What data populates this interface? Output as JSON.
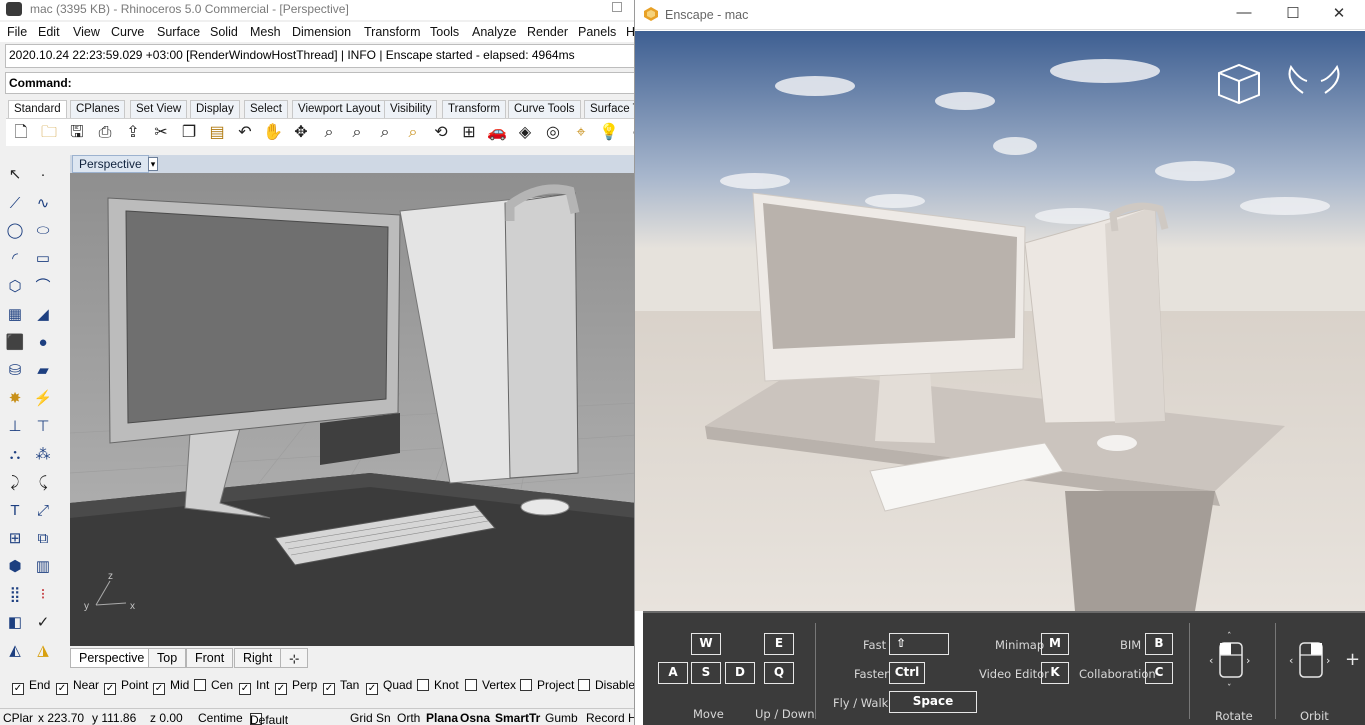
{
  "rhino": {
    "title": "mac (3395 KB) - Rhinoceros 5.0 Commercial - [Perspective]",
    "menu": [
      "File",
      "Edit",
      "View",
      "Curve",
      "Surface",
      "Solid",
      "Mesh",
      "Dimension",
      "Transform",
      "Tools",
      "Analyze",
      "Render",
      "Panels",
      "H"
    ],
    "history_line": "2020.10.24 22:23:59.029 +03:00 [RenderWindowHostThread] | INFO | Enscape started - elapsed: 4964ms",
    "command_label": "Command:",
    "toolbar_tabs": [
      "Standard",
      "CPlanes",
      "Set View",
      "Display",
      "Select",
      "Viewport Layout",
      "Visibility",
      "Transform",
      "Curve Tools",
      "Surface T"
    ],
    "toolbar_icons": [
      "new-icon",
      "open-icon",
      "save-icon",
      "print-icon",
      "import-icon",
      "cut-icon",
      "copy-icon",
      "paste-icon",
      "undo-icon",
      "pan-icon",
      "rotate-view-icon",
      "zoom-icon",
      "zoom-window-icon",
      "zoom-extents-icon",
      "zoom-selected-icon",
      "rotate-icon",
      "four-viewports-icon",
      "car-icon",
      "mesh-icon",
      "target-icon",
      "osnap-icon",
      "light-icon",
      "render-icon"
    ],
    "viewport_label": "Perspective",
    "axis_labels": [
      "y",
      "x",
      "z"
    ],
    "viewport_tabs": [
      "Perspective",
      "Top",
      "Front",
      "Right"
    ],
    "osnaps": [
      {
        "label": "End",
        "checked": true
      },
      {
        "label": "Near",
        "checked": true
      },
      {
        "label": "Point",
        "checked": true
      },
      {
        "label": "Mid",
        "checked": true
      },
      {
        "label": "Cen",
        "checked": false
      },
      {
        "label": "Int",
        "checked": true
      },
      {
        "label": "Perp",
        "checked": true
      },
      {
        "label": "Tan",
        "checked": true
      },
      {
        "label": "Quad",
        "checked": true
      },
      {
        "label": "Knot",
        "checked": false
      },
      {
        "label": "Vertex",
        "checked": false
      },
      {
        "label": "Project",
        "checked": false
      },
      {
        "label": "Disable",
        "checked": false
      }
    ],
    "status": {
      "cplane": "CPlar",
      "x": "x 223.70",
      "y": "y 111.86",
      "z": "z 0.00",
      "units": "Centime",
      "layer": "Default",
      "grid_snap": "Grid Sn",
      "ortho": "Orth",
      "planar": "Plana",
      "osnap": "Osna",
      "smarttrack": "SmartTr",
      "gumball": "Gumb",
      "record": "Record H"
    }
  },
  "enscape": {
    "title": "Enscape - mac",
    "help": {
      "move_keys": [
        "W",
        "A",
        "S",
        "D"
      ],
      "updown_keys": [
        "E",
        "Q"
      ],
      "move_label": "Move",
      "updown_label": "Up / Down",
      "fast_label": "Fast",
      "fast_key": "⇧",
      "faster_label": "Faster",
      "faster_key": "Ctrl",
      "fly_label": "Fly /  Walk",
      "fly_key": "Space",
      "minimap_label": "Minimap",
      "minimap_key": "M",
      "video_label": "Video Editor",
      "video_key": "K",
      "bim_label": "BIM",
      "bim_key": "B",
      "collab_label": "Collaboration",
      "collab_key": "C",
      "rotate_label": "Rotate",
      "orbit_label": "Orbit",
      "plus": "+"
    }
  }
}
